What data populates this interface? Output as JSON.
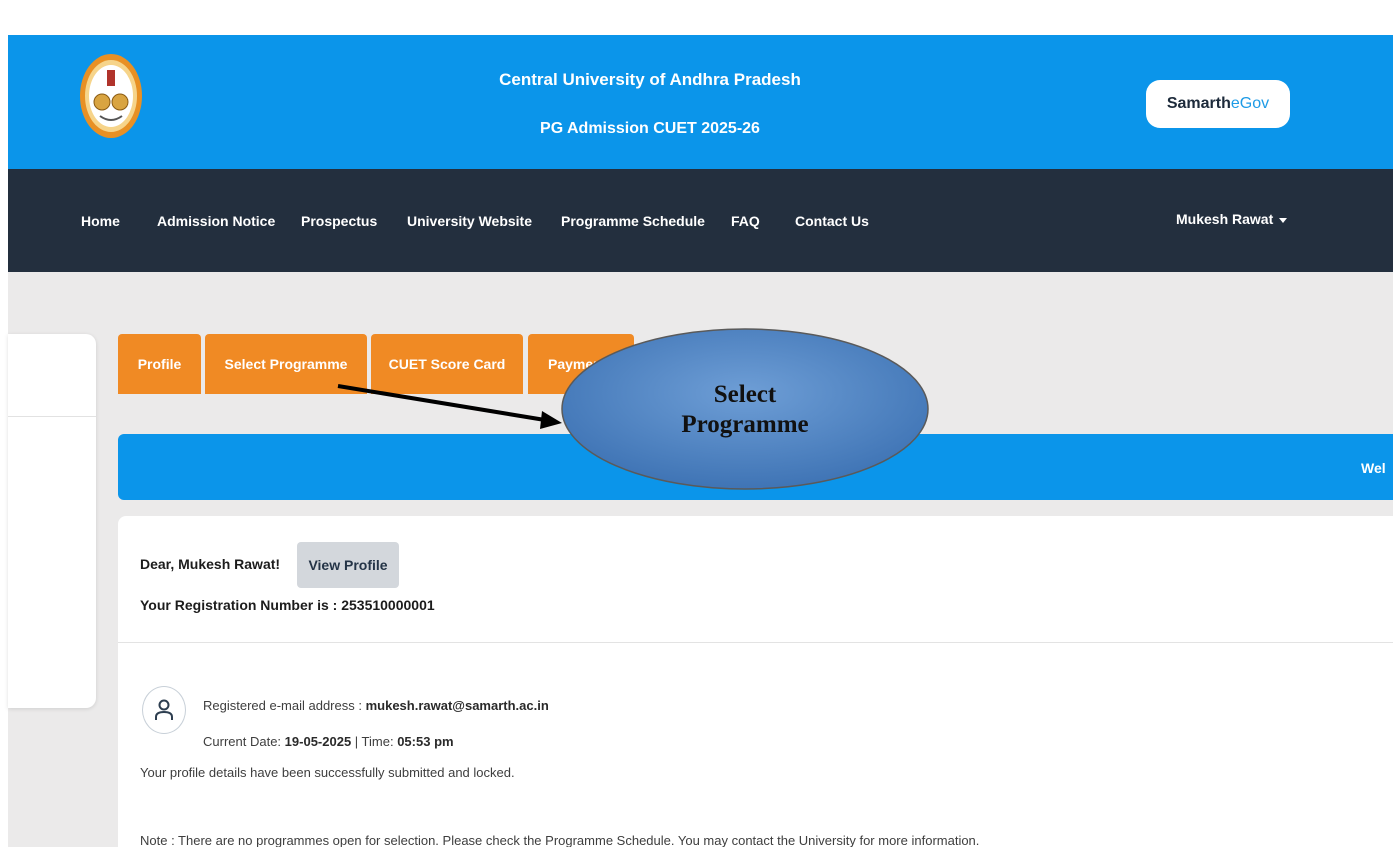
{
  "header": {
    "title": "Central University of Andhra Pradesh",
    "subtitle": "PG Admission CUET 2025-26",
    "brand_part1": "Samarth",
    "brand_part2": "eGov",
    "brand_color": "#0b95ea"
  },
  "nav": {
    "items": [
      "Home",
      "Admission Notice",
      "Prospectus",
      "University Website",
      "Programme Schedule",
      "FAQ",
      "Contact Us"
    ],
    "user_name": "Mukesh Rawat",
    "bg_color": "#232f3e"
  },
  "tabs": [
    "Profile",
    "Select Programme",
    "CUET Score Card",
    "Payment"
  ],
  "tab_color": "#f08a24",
  "welcome": {
    "text": "Wel"
  },
  "card": {
    "greeting": "Dear, Mukesh Rawat!",
    "view_profile_label": "View Profile",
    "registration_label": "Your Registration Number is : 253510000001",
    "email_label": "Registered e-mail address :",
    "email_value": "mukesh.rawat@samarth.ac.in",
    "date_label": "Current Date:",
    "date_value": "19-05-2025",
    "time_label": "| Time:",
    "time_value": "05:53 pm",
    "submitted_message": "Your profile details have been successfully submitted and locked.",
    "note": "Note : There are no programmes open for selection. Please check the Programme Schedule. You may contact the University for more information."
  },
  "annotation": {
    "callout_line1": "Select",
    "callout_line2": "Programme"
  }
}
